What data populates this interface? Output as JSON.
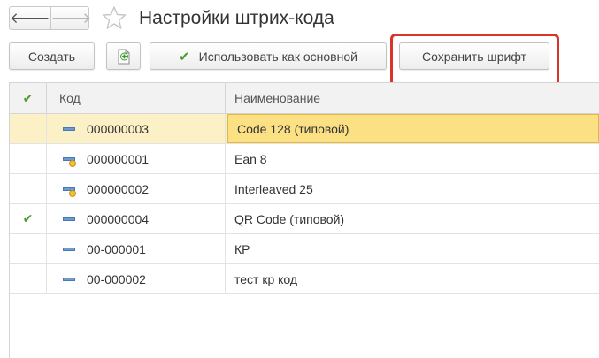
{
  "header": {
    "title": "Настройки штрих-кода",
    "back_glyph": "🡐",
    "forward_glyph": "🡒"
  },
  "toolbar": {
    "create_label": "Создать",
    "use_default_label": "Использовать как основной",
    "save_font_label": "Сохранить шрифт",
    "check_glyph": "✔"
  },
  "table": {
    "columns": {
      "default_check": "✔",
      "code": "Код",
      "name": "Наименование"
    },
    "rows": [
      {
        "check": "",
        "code": "000000003",
        "name": "Code 128 (типовой)",
        "icon": "catalog-item-icon",
        "selected": true
      },
      {
        "check": "",
        "code": "000000001",
        "name": "Ean 8",
        "icon": "catalog-item-user-icon",
        "selected": false
      },
      {
        "check": "",
        "code": "000000002",
        "name": "Interleaved 25",
        "icon": "catalog-item-user-icon",
        "selected": false
      },
      {
        "check": "✔",
        "code": "000000004",
        "name": "QR Code (типовой)",
        "icon": "catalog-item-icon",
        "selected": false
      },
      {
        "check": "",
        "code": "00-000001",
        "name": "КР",
        "icon": "catalog-item-icon",
        "selected": false
      },
      {
        "check": "",
        "code": "00-000002",
        "name": "тест кр код",
        "icon": "catalog-item-icon",
        "selected": false
      }
    ]
  },
  "colors": {
    "accent_check": "#4a9a34",
    "selection": "#fbe084",
    "highlight_frame": "#d9342b"
  }
}
